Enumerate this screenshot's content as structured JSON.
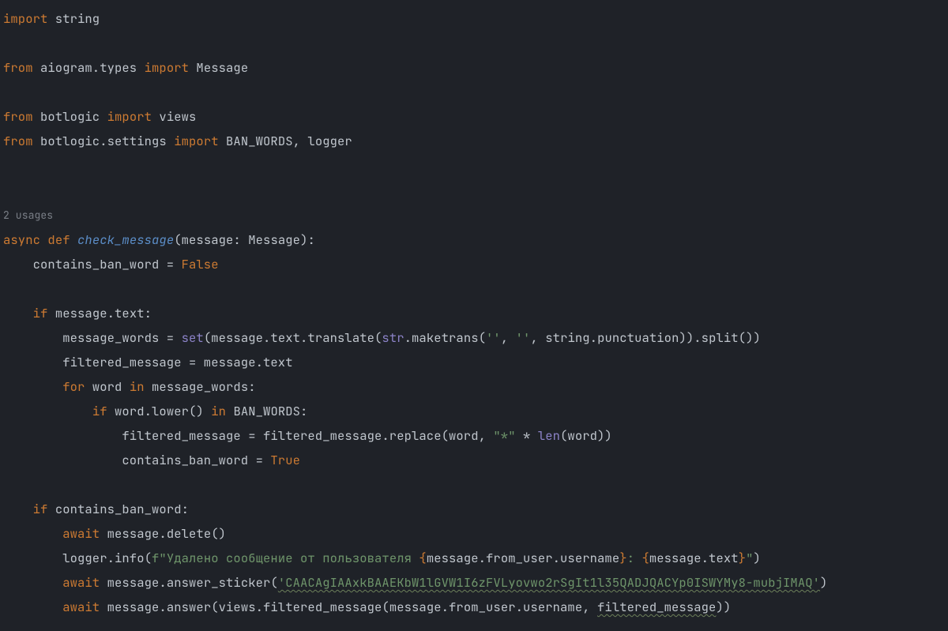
{
  "inlay": {
    "usages": "2 usages"
  },
  "code": {
    "l01_import": "import",
    "l01_string": " string",
    "l03_from": "from",
    "l03_mod1": " aiogram.types ",
    "l03_import": "import",
    "l03_msg": " Message",
    "l05_from": "from",
    "l05_mod": " botlogic ",
    "l05_import": "import",
    "l05_views": " views",
    "l06_from": "from",
    "l06_mod": " botlogic.settings ",
    "l06_import": "import",
    "l06_names": " BAN_WORDS, logger",
    "l09_async": "async",
    "l09_def": " def ",
    "l09_fn": "check_message",
    "l09_sig1": "(message: ",
    "l09_cls": "Message",
    "l09_sig2": "):",
    "l10": "    contains_ban_word = ",
    "l10_false": "False",
    "l12_if": "if",
    "l12_rest": " message.text:",
    "l13_a": "        message_words = ",
    "l13_set": "set",
    "l13_b": "(message.text.translate(",
    "l13_str": "str",
    "l13_c": ".maketrans(",
    "l13_s1": "''",
    "l13_comma1": ", ",
    "l13_s2": "''",
    "l13_comma2": ", ",
    "l13_d": "string.punctuation)).split())",
    "l14": "        filtered_message = message.text",
    "l15_for": "for",
    "l15_a": " word ",
    "l15_in": "in",
    "l15_b": " message_words:",
    "l16_if": "if",
    "l16_a": " word.lower() ",
    "l16_in": "in",
    "l16_b": " BAN_WORDS:",
    "l17_a": "                filtered_message = filtered_message.replace(word, ",
    "l17_star": "\"*\"",
    "l17_b": " * ",
    "l17_len": "len",
    "l17_c": "(word))",
    "l18_a": "                contains_ban_word = ",
    "l18_true": "True",
    "l20_if": "if",
    "l20_rest": " contains_ban_word:",
    "l21_await": "await",
    "l21_rest": " message.delete()",
    "l22_a": "        logger.info(",
    "l22_f": "f\"Удалено сообщение от пользователя ",
    "l22_lb1": "{",
    "l22_e1": "message.from_user.username",
    "l22_rb1": "}",
    "l22_mid": ": ",
    "l22_lb2": "{",
    "l22_e2": "message.text",
    "l22_rb2": "}",
    "l22_end": "\"",
    "l22_paren": ")",
    "l23_await": "await",
    "l23_a": " message.answer_sticker(",
    "l23_s": "'CAACAgIAAxkBAAEKbW1lGVW1I6zFVLyovwo2rSgIt1l35QADJQACYp0ISWYMy8-mubjIMAQ'",
    "l23_b": ")",
    "l24_await": "await",
    "l24_a": " message.answer(views.filtered_message(message.from_user.username, ",
    "l24_fm": "filtered_message",
    "l24_b": "))"
  }
}
